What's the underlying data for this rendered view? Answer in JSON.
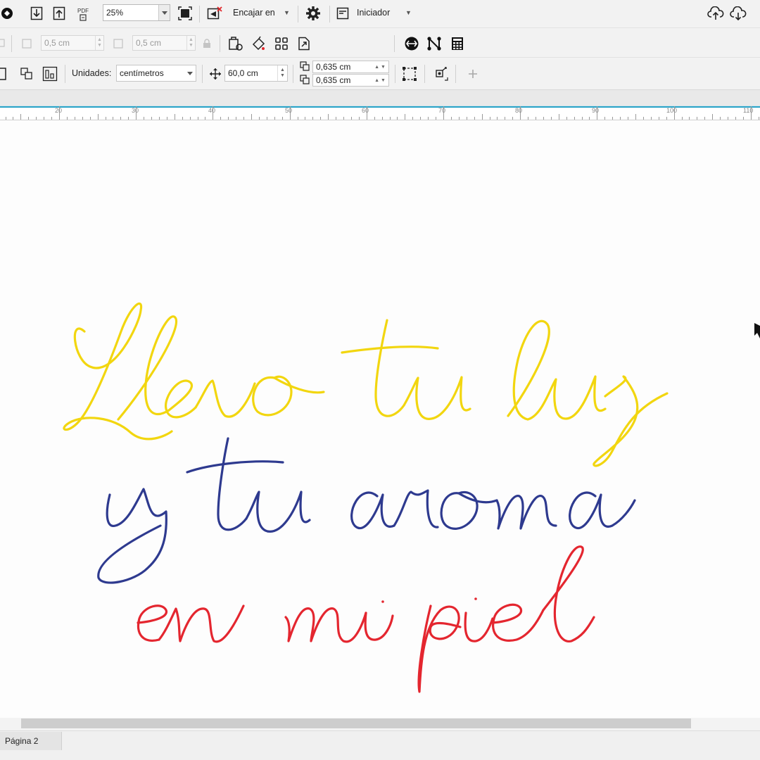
{
  "toolbar": {
    "zoom_value": "25%",
    "snap_label": "Encajar en",
    "launch_label": "Iniciador",
    "pdf_label": "PDF"
  },
  "property_bar": {
    "nudge_x_value": "0,5 cm",
    "nudge_y_value": "0,5 cm",
    "units_label": "Unidades:",
    "units_value": "centímetros",
    "nudge_distance": "60,0 cm",
    "duplicate_x": "0,635 cm",
    "duplicate_y": "0,635 cm"
  },
  "ruler": {
    "labels": [
      "20",
      "30",
      "40",
      "50",
      "60",
      "70",
      "80",
      "90",
      "100",
      "110"
    ]
  },
  "status": {
    "page_tab": "Página 2"
  },
  "colors": {
    "line1": "#f2d60f",
    "line2": "#2e3a8f",
    "line3": "#e4262f",
    "ruler_accent": "#2aa3c7"
  },
  "icons": [
    "publish-icon",
    "import-icon",
    "export-icon",
    "pdf-icon",
    "full-screen-icon",
    "snap-off-icon",
    "settings-gear-icon",
    "launch-icon",
    "cloud-upload-icon",
    "cloud-download-icon",
    "lock-ratio-icon",
    "page-options-icon",
    "paint-tool-icon",
    "grid-icon",
    "page-export-icon",
    "color-wheel-icon",
    "node-icon",
    "calculator-icon",
    "page-size-icon",
    "arrange-icon",
    "units-move-icon",
    "duplicate-x-icon",
    "duplicate-y-icon",
    "select-page-icon",
    "transform-icon",
    "add-icon"
  ]
}
